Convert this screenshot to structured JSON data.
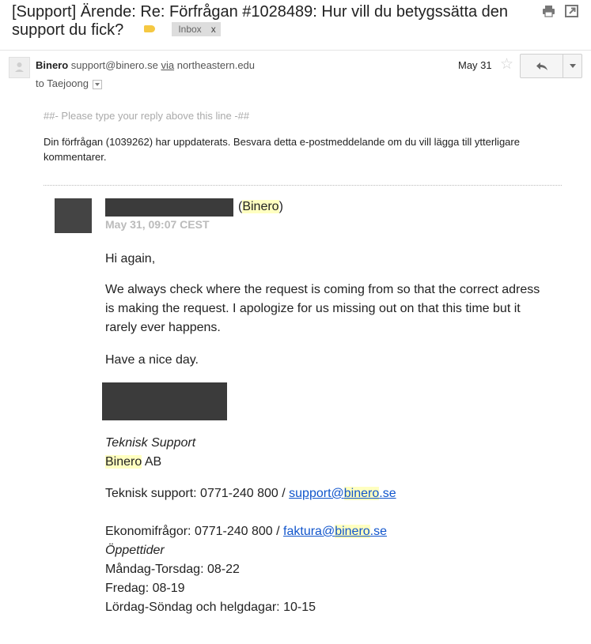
{
  "header": {
    "subject": "[Support] Ärende: Re: Förfrågan #1028489: Hur vill du betygssätta den support du fick?",
    "inbox_label": "Inbox",
    "inbox_remove": "x",
    "label_color": "#f5c842"
  },
  "sender": {
    "name": "Binero",
    "email": "support@binero.se",
    "via_word": "via",
    "via_domain": "northeastern.edu",
    "to": "to Taejoong",
    "date": "May 31",
    "star_glyph": "☆"
  },
  "body": {
    "reply_hint": "##- Please type your reply above this line -##",
    "intro": "Din förfrågan (1039262) har uppdaterats. Besvara detta e-postmeddelande om du vill lägga till ytterligare kommentarer.",
    "company": "Binero",
    "timestamp": "May 31, 09:07 CEST",
    "greeting": "Hi again,",
    "paragraph": "We always check where the request is coming from so that the correct adress is making the request. I apologize for us missing out on that this time but it rarely ever happens.",
    "closing": "Have a nice day."
  },
  "signature": {
    "role": "Teknisk Support",
    "company_name": "Binero",
    "company_suffix": "AB",
    "support_label": "Teknisk support: 0771-240 800 / ",
    "support_email_pre": "support@",
    "support_email_hl": "binero",
    "support_email_post": ".se",
    "economy_label": "Ekonomifrågor: 0771-240 800 / ",
    "economy_email_pre": "faktura@",
    "economy_email_hl": "binero",
    "economy_email_post": ".se",
    "hours_title": "Öppettider",
    "hours_weekdays": "Måndag-Torsdag: 08-22",
    "hours_friday": "Fredag: 08-19",
    "hours_weekend": "Lördag-Söndag och helgdagar: 10-15"
  }
}
